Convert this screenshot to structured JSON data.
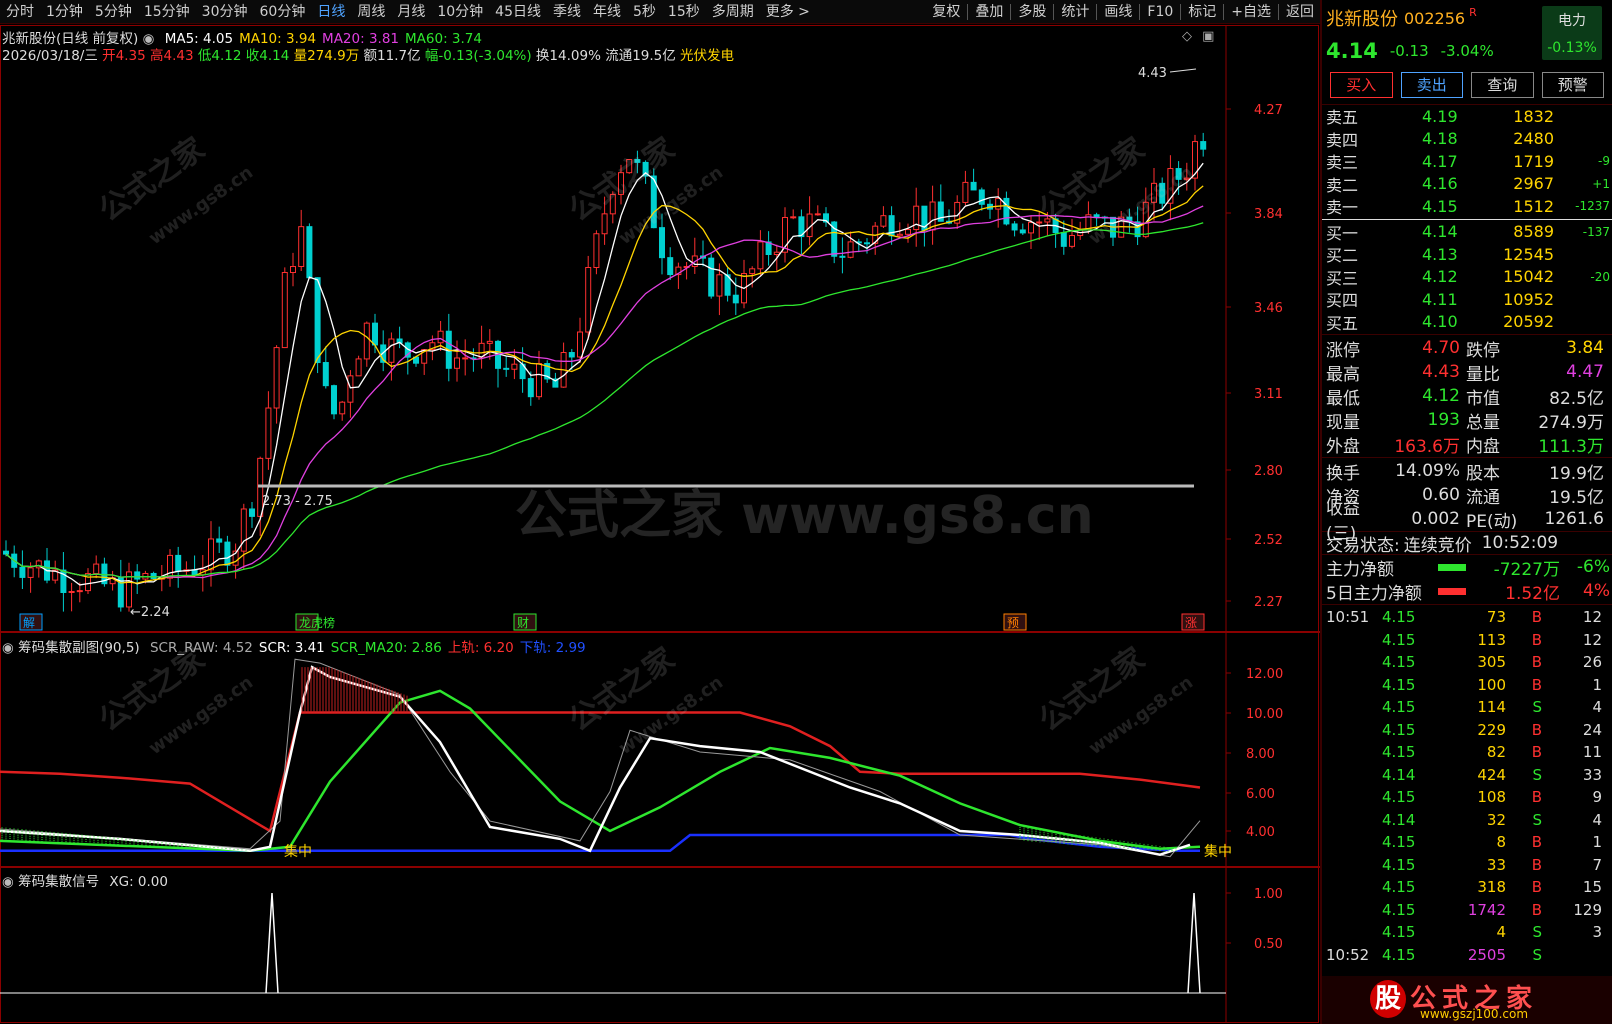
{
  "menu": {
    "left": [
      "分时",
      "1分钟",
      "5分钟",
      "15分钟",
      "30分钟",
      "60分钟",
      "日线",
      "周线",
      "月线",
      "10分钟",
      "45日线",
      "季线",
      "年线",
      "5秒",
      "15秒",
      "多周期",
      "更多 >"
    ],
    "active": "日线",
    "right": [
      "复权",
      "叠加",
      "多股",
      "统计",
      "画线",
      "F10",
      "标记",
      "+自选",
      "返回"
    ]
  },
  "main_chart": {
    "title": "兆新股份(日线 前复权)",
    "ma": [
      {
        "label": "MA5: 4.05",
        "color": "#ffffff"
      },
      {
        "label": "MA10: 3.94",
        "color": "#ffd400"
      },
      {
        "label": "MA20: 3.81",
        "color": "#e040e0"
      },
      {
        "label": "MA60: 3.74",
        "color": "#2ee62e"
      }
    ],
    "ohlc_line": [
      {
        "text": "2026/03/18/三",
        "color": "#dddddd"
      },
      {
        "text": " 开4.35",
        "color": "#ff3030"
      },
      {
        "text": " 高4.43",
        "color": "#ff3030"
      },
      {
        "text": " 低4.12",
        "color": "#2ee62e"
      },
      {
        "text": " 收4.14",
        "color": "#2ee62e"
      },
      {
        "text": " 量274.9万",
        "color": "#ffd400"
      },
      {
        "text": " 额11.7亿",
        "color": "#dddddd"
      },
      {
        "text": " 幅-0.13(-3.04%)",
        "color": "#2ee62e"
      },
      {
        "text": " 换14.09%",
        "color": "#dddddd"
      },
      {
        "text": " 流通19.5亿",
        "color": "#dddddd"
      },
      {
        "text": " 光伏发电",
        "color": "#ffd400"
      }
    ],
    "price_axis": [
      "4.27",
      "3.84",
      "3.46",
      "3.11",
      "2.80",
      "2.52",
      "2.27"
    ],
    "annotations": {
      "high_label": "4.43",
      "range_label": "2.73 - 2.75",
      "low_label": "2.24"
    },
    "markers": [
      "解",
      "龙虎榜",
      "财",
      "预",
      "涨"
    ]
  },
  "indicator1": {
    "title": "筹码集散副图(90,5)",
    "fields": [
      {
        "text": "SCR_RAW: 4.52",
        "color": "#aaaaaa"
      },
      {
        "text": "SCR: 3.41",
        "color": "#ffffff"
      },
      {
        "text": "SCR_MA20: 2.86",
        "color": "#2ee62e"
      },
      {
        "text": "上轨: 6.20",
        "color": "#ff3030"
      },
      {
        "text": "下轨: 2.99",
        "color": "#2050ff"
      }
    ],
    "axis": [
      "12.00",
      "10.00",
      "8.00",
      "6.00",
      "4.00"
    ],
    "label_left": "集中",
    "label_right": "集中"
  },
  "indicator2": {
    "title": "筹码集散信号",
    "field": "XG: 0.00",
    "axis": [
      "1.00",
      "0.50"
    ]
  },
  "quote": {
    "name": "兆新股份",
    "code": "002256",
    "flag": "R",
    "power_label": "电力",
    "power_change": "-0.13%",
    "price": "4.14",
    "change": "-0.13",
    "change_pct": "-3.04%",
    "buttons": [
      "买入",
      "卖出",
      "查询",
      "预警"
    ]
  },
  "orderbook": {
    "asks": [
      {
        "label": "卖五",
        "price": "4.19",
        "vol": "1832",
        "extra": ""
      },
      {
        "label": "卖四",
        "price": "4.18",
        "vol": "2480",
        "extra": ""
      },
      {
        "label": "卖三",
        "price": "4.17",
        "vol": "1719",
        "extra": "-9"
      },
      {
        "label": "卖二",
        "price": "4.16",
        "vol": "2967",
        "extra": "+1"
      },
      {
        "label": "卖一",
        "price": "4.15",
        "vol": "1512",
        "extra": "-1237"
      }
    ],
    "bids": [
      {
        "label": "买一",
        "price": "4.14",
        "vol": "8589",
        "extra": "-137"
      },
      {
        "label": "买二",
        "price": "4.13",
        "vol": "12545",
        "extra": ""
      },
      {
        "label": "买三",
        "price": "4.12",
        "vol": "15042",
        "extra": "-20"
      },
      {
        "label": "买四",
        "price": "4.11",
        "vol": "10952",
        "extra": ""
      },
      {
        "label": "买五",
        "price": "4.10",
        "vol": "20592",
        "extra": ""
      }
    ]
  },
  "stats": [
    {
      "l1": "涨停",
      "v1": "4.70",
      "c1": "#ff3030",
      "l2": "跌停",
      "v2": "3.84",
      "c2": "#ffd400"
    },
    {
      "l1": "最高",
      "v1": "4.43",
      "c1": "#ff3030",
      "l2": "量比",
      "v2": "4.47",
      "c2": "#e040e0"
    },
    {
      "l1": "最低",
      "v1": "4.12",
      "c1": "#2ee62e",
      "l2": "市值",
      "v2": "82.5亿",
      "c2": "#dddddd"
    },
    {
      "l1": "现量",
      "v1": "193",
      "c1": "#2ee62e",
      "l2": "总量",
      "v2": "274.9万",
      "c2": "#dddddd"
    },
    {
      "l1": "外盘",
      "v1": "163.6万",
      "c1": "#ff3030",
      "l2": "内盘",
      "v2": "111.3万",
      "c2": "#2ee62e"
    },
    {
      "l1": "换手",
      "v1": "14.09%",
      "c1": "#dddddd",
      "l2": "股本",
      "v2": "19.9亿",
      "c2": "#dddddd"
    },
    {
      "l1": "净资",
      "v1": "0.60",
      "c1": "#dddddd",
      "l2": "流通",
      "v2": "19.5亿",
      "c2": "#dddddd"
    },
    {
      "l1": "收益(三)",
      "v1": "0.002",
      "c1": "#dddddd",
      "l2": "PE(动)",
      "v2": "1261.6",
      "c2": "#dddddd"
    }
  ],
  "trade_status": {
    "label": "交易状态:",
    "value": "连续竞价",
    "time": "10:52:09"
  },
  "flows": [
    {
      "label": "主力净额",
      "value": "-7227万",
      "pct": "-6%",
      "color": "#2ee62e",
      "bar": "#2ee62e"
    },
    {
      "label": "5日主力净额",
      "value": "1.52亿",
      "pct": "4%",
      "color": "#ff3030",
      "bar": "#ff3030"
    }
  ],
  "ticks": [
    {
      "t": "10:51",
      "p": "4.15",
      "v": "73",
      "d": "B",
      "n": "12",
      "vc": "#ffd400"
    },
    {
      "t": "",
      "p": "4.15",
      "v": "113",
      "d": "B",
      "n": "12",
      "vc": "#ffd400"
    },
    {
      "t": "",
      "p": "4.15",
      "v": "305",
      "d": "B",
      "n": "26",
      "vc": "#ffd400"
    },
    {
      "t": "",
      "p": "4.15",
      "v": "100",
      "d": "B",
      "n": "1",
      "vc": "#ffd400"
    },
    {
      "t": "",
      "p": "4.15",
      "v": "114",
      "d": "S",
      "n": "4",
      "vc": "#ffd400"
    },
    {
      "t": "",
      "p": "4.15",
      "v": "229",
      "d": "B",
      "n": "24",
      "vc": "#ffd400"
    },
    {
      "t": "",
      "p": "4.15",
      "v": "82",
      "d": "B",
      "n": "11",
      "vc": "#ffd400"
    },
    {
      "t": "",
      "p": "4.14",
      "v": "424",
      "d": "S",
      "n": "33",
      "vc": "#ffd400"
    },
    {
      "t": "",
      "p": "4.15",
      "v": "108",
      "d": "B",
      "n": "9",
      "vc": "#ffd400"
    },
    {
      "t": "",
      "p": "4.14",
      "v": "32",
      "d": "S",
      "n": "4",
      "vc": "#ffd400"
    },
    {
      "t": "",
      "p": "4.15",
      "v": "8",
      "d": "B",
      "n": "1",
      "vc": "#ffd400"
    },
    {
      "t": "",
      "p": "4.15",
      "v": "33",
      "d": "B",
      "n": "7",
      "vc": "#ffd400"
    },
    {
      "t": "",
      "p": "4.15",
      "v": "318",
      "d": "B",
      "n": "15",
      "vc": "#ffd400"
    },
    {
      "t": "",
      "p": "4.15",
      "v": "1742",
      "d": "B",
      "n": "129",
      "vc": "#e040e0"
    },
    {
      "t": "",
      "p": "4.15",
      "v": "4",
      "d": "S",
      "n": "3",
      "vc": "#ffd400"
    },
    {
      "t": "10:52",
      "p": "4.15",
      "v": "2505",
      "d": "S",
      "n": "",
      "vc": "#e040e0"
    }
  ],
  "watermark": {
    "center": "公式之家 www.gs8.cn",
    "tile": "公式之家",
    "tile_url": "www.gs8.cn",
    "logo": "公式之家",
    "logo_mark": "股",
    "logo_url": "www.gszj100.com"
  },
  "colors": {
    "up": "#ff3030",
    "down": "#2ee62e",
    "ma5": "#ffffff",
    "ma10": "#ffd400",
    "ma20": "#e040e0",
    "ma60": "#2ee62e",
    "grid": "#8b0000"
  }
}
